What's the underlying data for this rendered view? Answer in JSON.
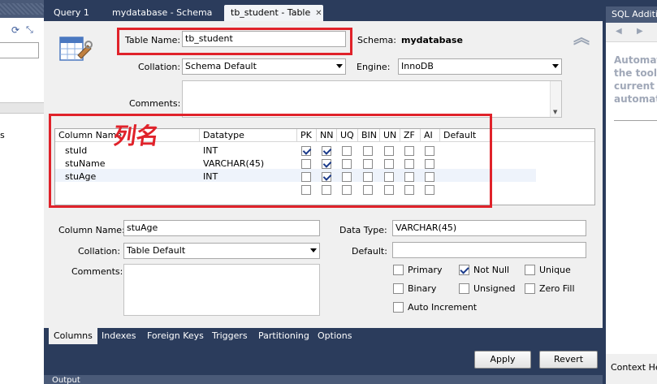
{
  "tabs": [
    {
      "label": "Query 1",
      "active": false
    },
    {
      "label": "mydatabase - Schema",
      "active": false
    },
    {
      "label": "tb_student - Table",
      "active": true
    }
  ],
  "table": {
    "name_label": "Table Name:",
    "name_value": "tb_student",
    "schema_label": "Schema:",
    "schema_value": "mydatabase",
    "collation_label": "Collation:",
    "collation_value": "Schema Default",
    "engine_label": "Engine:",
    "engine_value": "InnoDB",
    "comments_label": "Comments:"
  },
  "grid": {
    "headers": [
      "Column Name",
      "Datatype",
      "PK",
      "NN",
      "UQ",
      "BIN",
      "UN",
      "ZF",
      "AI",
      "Default"
    ],
    "rows": [
      {
        "name": "stuId",
        "type": "INT",
        "flags": [
          true,
          true,
          false,
          false,
          false,
          false,
          false
        ]
      },
      {
        "name": "stuName",
        "type": "VARCHAR(45)",
        "flags": [
          false,
          true,
          false,
          false,
          false,
          false,
          false
        ]
      },
      {
        "name": "stuAge",
        "type": "INT",
        "flags": [
          false,
          true,
          false,
          false,
          false,
          false,
          false
        ]
      },
      {
        "name": "",
        "type": "",
        "flags": [
          false,
          false,
          false,
          false,
          false,
          false,
          false
        ]
      }
    ],
    "annotation": "列名"
  },
  "details": {
    "column_name_label": "Column Name:",
    "column_name_value": "stuAge",
    "data_type_label": "Data Type:",
    "data_type_value": "VARCHAR(45)",
    "collation_label": "Collation:",
    "collation_value": "Table Default",
    "default_label": "Default:",
    "default_value": "",
    "comments_label": "Comments:",
    "options": [
      {
        "label": "Primary",
        "checked": false
      },
      {
        "label": "Not Null",
        "checked": true
      },
      {
        "label": "Unique",
        "checked": false
      },
      {
        "label": "Binary",
        "checked": false
      },
      {
        "label": "Unsigned",
        "checked": false
      },
      {
        "label": "Zero Fill",
        "checked": false
      },
      {
        "label": "Auto Increment",
        "checked": false
      }
    ]
  },
  "subtabs": [
    "Columns",
    "Indexes",
    "Foreign Keys",
    "Triggers",
    "Partitioning",
    "Options"
  ],
  "actions": {
    "apply": "Apply",
    "revert": "Revert"
  },
  "output_label": "Output",
  "right_panel": {
    "title": "SQL Additions",
    "help_lines": [
      "Automatic",
      "the toolb",
      "current",
      "automatic"
    ],
    "footer": "Context Help"
  },
  "left_panel": {
    "stub_text": "s"
  },
  "colors": {
    "accent_red": "#e0222a",
    "chrome": "#2b3c5c"
  }
}
